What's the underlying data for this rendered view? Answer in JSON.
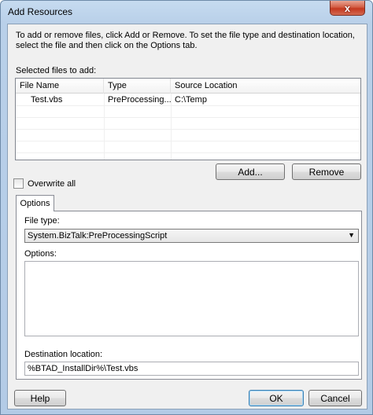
{
  "window": {
    "title": "Add Resources",
    "close_glyph": "x"
  },
  "instructions": "To add or remove files,  click Add or Remove. To set the file type and destination location, select the file and then click on the Options tab.",
  "selected_files": {
    "label": "Selected files to add:",
    "columns": [
      "File Name",
      "Type",
      "Source Location"
    ],
    "rows": [
      {
        "file_name": "Test.vbs",
        "type": "PreProcessing...",
        "source": "C:\\Temp"
      }
    ]
  },
  "buttons": {
    "add": "Add...",
    "remove": "Remove",
    "help": "Help",
    "ok": "OK",
    "cancel": "Cancel"
  },
  "overwrite_all": {
    "label": "Overwrite all",
    "checked": false
  },
  "tabs": [
    {
      "label": "Options",
      "selected": true
    }
  ],
  "options": {
    "file_type_label": "File type:",
    "file_type_value": "System.BizTalk:PreProcessingScript",
    "options_label": "Options:",
    "options_value": "",
    "destination_label": "Destination location:",
    "destination_value": "%BTAD_InstallDir%\\Test.vbs"
  },
  "icons": {
    "dropdown": "chevron-down-icon",
    "close": "close-icon"
  }
}
